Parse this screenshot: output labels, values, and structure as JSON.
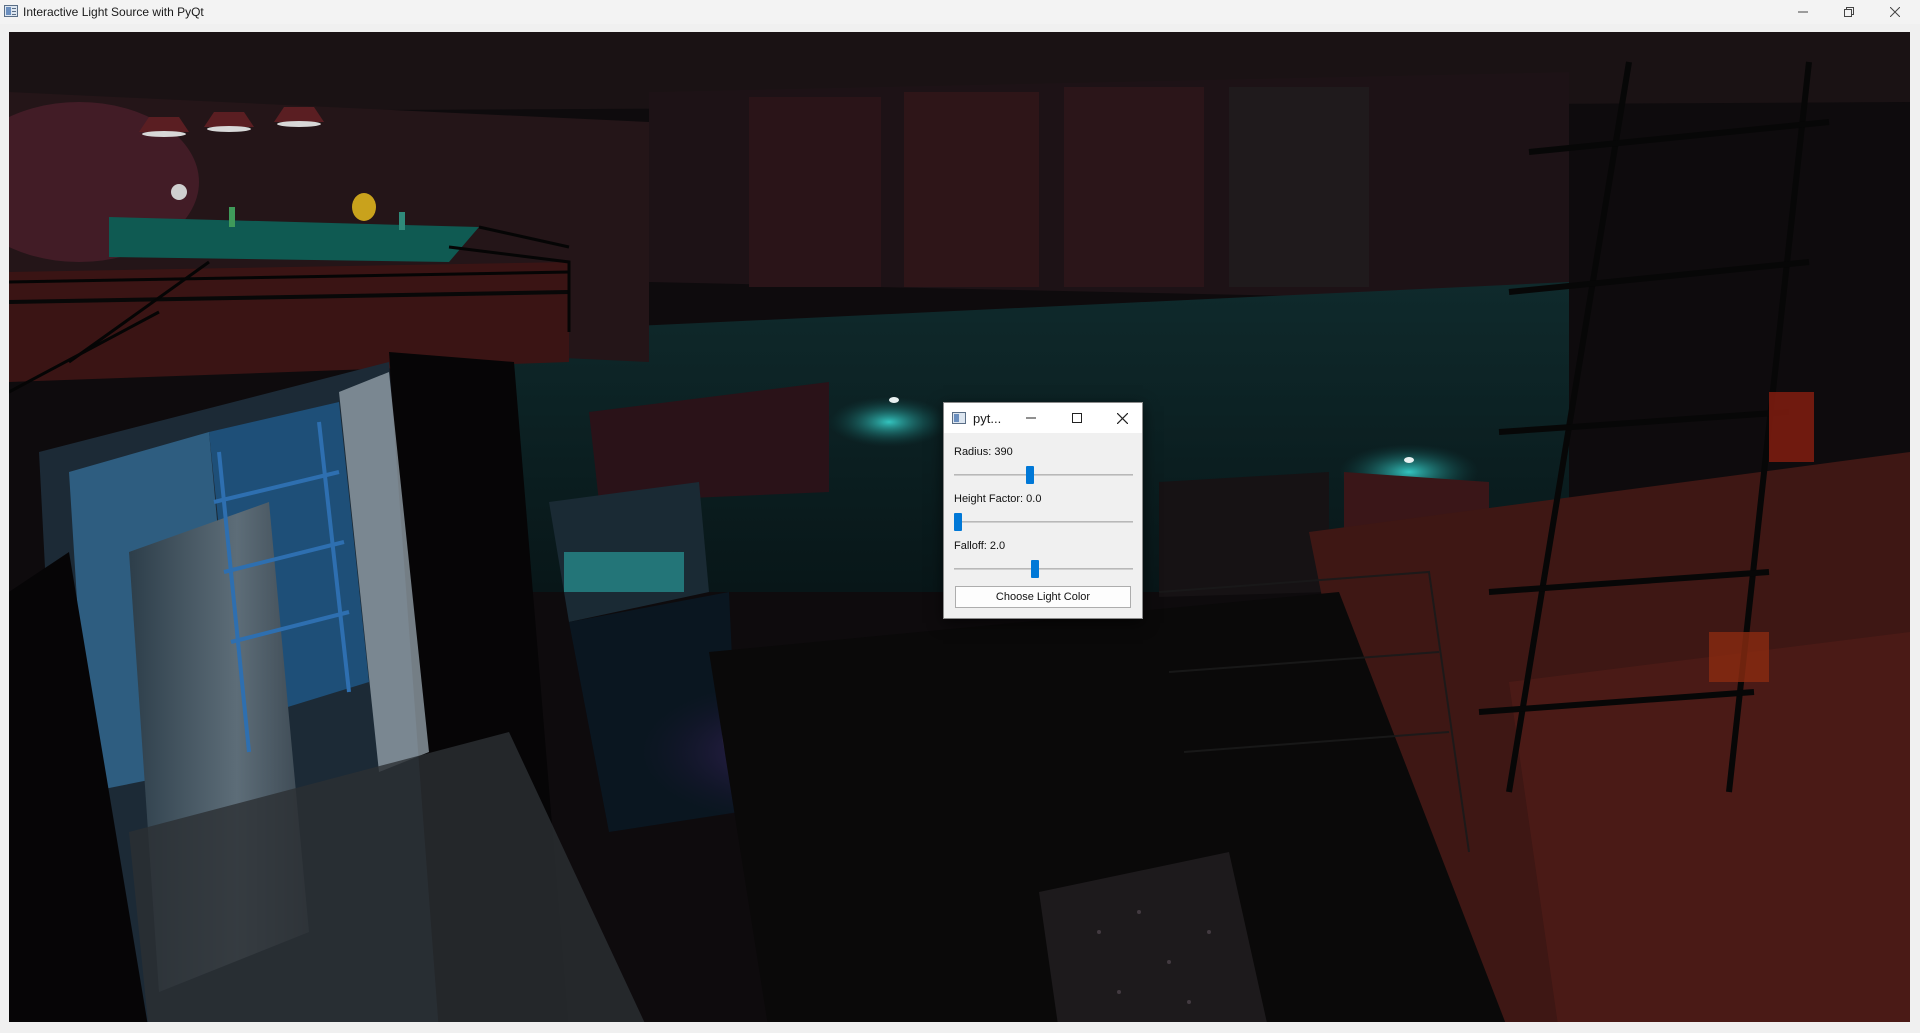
{
  "window": {
    "title": "Interactive Light Source with PyQt",
    "icon": "app-window-icon",
    "controls": [
      "minimize-icon",
      "restore-icon",
      "close-icon"
    ]
  },
  "dialog": {
    "title": "pyt...",
    "icon": "app-window-icon",
    "controls": [
      "minimize-icon",
      "maximize-icon",
      "close-icon"
    ],
    "radius": {
      "label": "Radius: 390",
      "value": 390,
      "position_fraction": 0.42
    },
    "height_factor": {
      "label": "Height Factor: 0.0",
      "value": 0.0,
      "position_fraction": 0.0
    },
    "falloff": {
      "label": "Falloff: 2.0",
      "value": 2.0,
      "position_fraction": 0.45
    },
    "color_button_label": "Choose Light Color",
    "accent_color": "#0078d7"
  }
}
